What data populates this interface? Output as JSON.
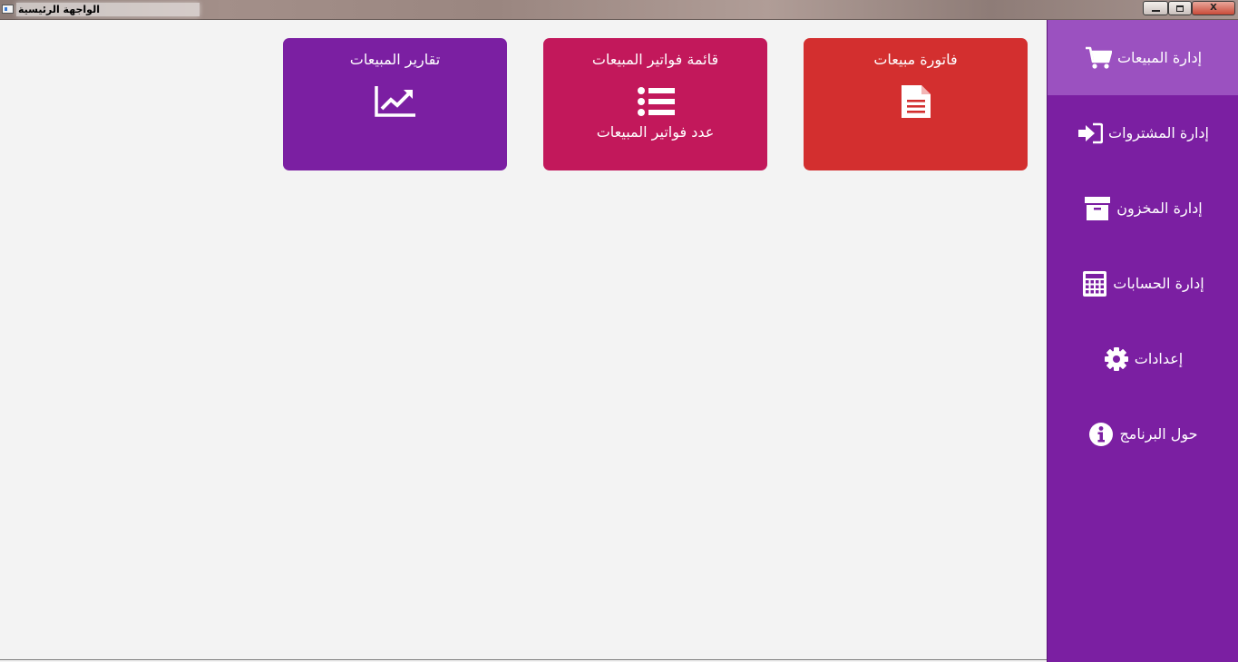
{
  "window": {
    "title": "الواجهة الرئيسية",
    "minimize_label": "",
    "maximize_label": "",
    "close_label": "X"
  },
  "sidebar": {
    "items": [
      {
        "label": "إدارة المبيعات",
        "icon": "shopping-cart-icon",
        "active": true
      },
      {
        "label": "إدارة المشتروات",
        "icon": "sign-in-icon",
        "active": false
      },
      {
        "label": "إدارة المخزون",
        "icon": "archive-box-icon",
        "active": false
      },
      {
        "label": "إدارة الحسابات",
        "icon": "calculator-icon",
        "active": false
      },
      {
        "label": "إعدادات",
        "icon": "gear-icon",
        "active": false
      },
      {
        "label": "حول البرنامج",
        "icon": "info-icon",
        "active": false
      }
    ]
  },
  "tiles": [
    {
      "title": "فاتورة مبيعات",
      "subtitle": "",
      "icon": "document-icon",
      "color": "#d32f2f"
    },
    {
      "title": "قائمة فواتير المبيعات",
      "subtitle": "عدد فواتير المبيعات",
      "icon": "list-icon",
      "color": "#c2185b"
    },
    {
      "title": "تقارير المبيعات",
      "subtitle": "",
      "icon": "line-chart-icon",
      "color": "#7b1fa2"
    }
  ],
  "colors": {
    "sidebar_bg": "#7b1fa2",
    "sidebar_active": "#9b51c0",
    "content_bg": "#f3f3f3"
  }
}
